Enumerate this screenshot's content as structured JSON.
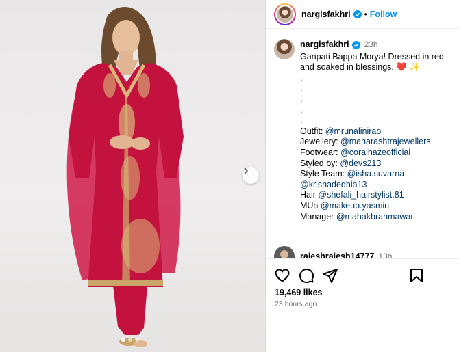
{
  "post": {
    "username": "nargisfakhri",
    "header_separator": "•",
    "follow_label": "Follow",
    "time_short": "23h",
    "caption_line1": "Ganpati Bappa Morya! Dressed in red and soaked in blessings. ",
    "caption_emoji_heart": "❤️",
    "caption_emoji_sparkles": "✨",
    "dot": ".",
    "credits": [
      {
        "label": "Outfit: ",
        "handle": "@mrunalinirao"
      },
      {
        "label": "Jewellery:  ",
        "handle": "@maharashtrajewellers"
      },
      {
        "label": "Footwear: ",
        "handle": "@coralhazeofficial"
      },
      {
        "label": "Styled by: ",
        "handle": "@devs213"
      },
      {
        "label": "Style Team: ",
        "handle": "@isha.suvarna"
      },
      {
        "label": "",
        "handle": "@krishadedhia13"
      },
      {
        "label": "Hair ",
        "handle": "@shefali_hairstylist.81"
      },
      {
        "label": "MUa ",
        "handle": "@makeup.yasmin"
      },
      {
        "label": "Manager ",
        "handle": "@mahakbrahmawar"
      }
    ],
    "likes": "19,469 likes",
    "time_long": "23 hours ago"
  },
  "comment": {
    "username": "rajeshrajesh14777",
    "time": "13h"
  },
  "carousel": {
    "total": 3,
    "active_index": 0
  },
  "colors": {
    "accent": "#0095f6",
    "mention": "#00376b",
    "muted": "#737373",
    "dress": "#c4123f"
  },
  "icons": [
    "verified-badge-icon",
    "chevron-right-icon",
    "heart-outline-icon",
    "comment-icon",
    "share-icon",
    "bookmark-icon"
  ]
}
